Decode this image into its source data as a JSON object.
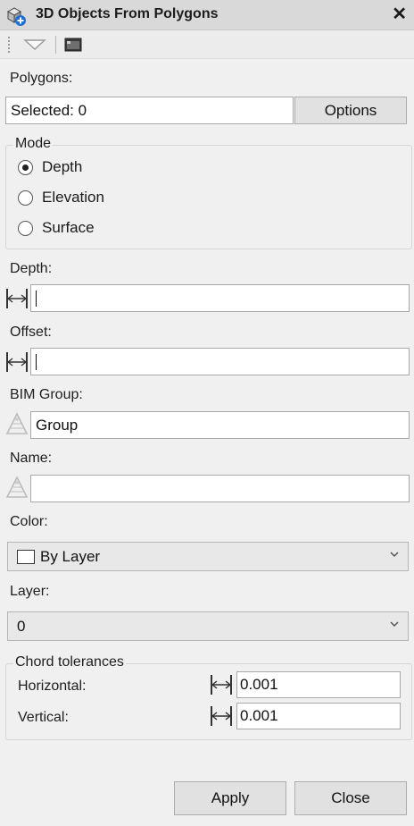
{
  "window": {
    "title": "3D Objects From Polygons"
  },
  "polygons": {
    "label": "Polygons:",
    "selected_text": "Selected: 0",
    "options_label": "Options"
  },
  "mode": {
    "title": "Mode",
    "options": [
      {
        "label": "Depth",
        "checked": true
      },
      {
        "label": "Elevation",
        "checked": false
      },
      {
        "label": "Surface",
        "checked": false
      }
    ]
  },
  "depth": {
    "label": "Depth:",
    "value": ""
  },
  "offset": {
    "label": "Offset:",
    "value": ""
  },
  "bim_group": {
    "label": "BIM Group:",
    "value": "Group"
  },
  "name": {
    "label": "Name:",
    "value": ""
  },
  "color": {
    "label": "Color:",
    "value": "By Layer"
  },
  "layer": {
    "label": "Layer:",
    "value": "0"
  },
  "chord": {
    "title": "Chord tolerances",
    "horizontal_label": "Horizontal:",
    "horizontal_value": "0.001",
    "vertical_label": "Vertical:",
    "vertical_value": "0.001"
  },
  "footer": {
    "apply_label": "Apply",
    "close_label": "Close"
  },
  "icons": {
    "app": "3d-objects-icon",
    "close": "close-icon",
    "toolbar_grip": "grip-icon",
    "toolbar_menu": "dropdown-triangle-icon",
    "toolbar_window": "window-icon",
    "dimension": "dimension-icon",
    "object": "object-icon",
    "chevron": "chevron-down-icon"
  }
}
